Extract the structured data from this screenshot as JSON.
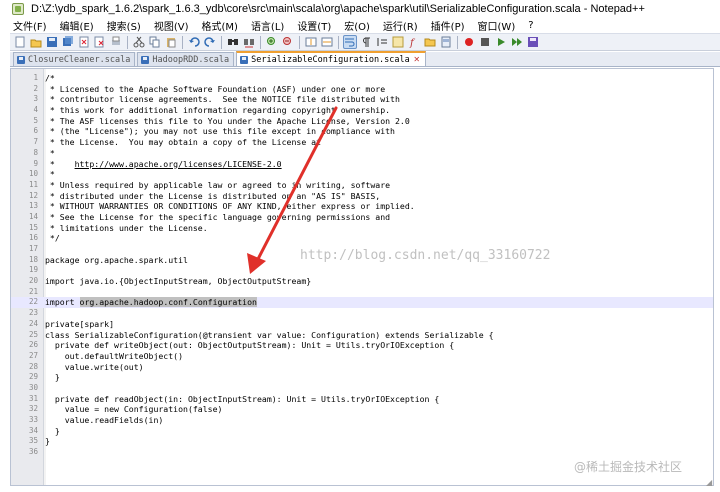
{
  "window": {
    "title": "D:\\Z:\\ydb_spark_1.6.2\\spark_1.6.3_ydb\\core\\src\\main\\scala\\org\\apache\\spark\\util\\SerializableConfiguration.scala - Notepad++"
  },
  "menu": [
    {
      "label": "文件(F)"
    },
    {
      "label": "编辑(E)"
    },
    {
      "label": "搜索(S)"
    },
    {
      "label": "视图(V)"
    },
    {
      "label": "格式(M)"
    },
    {
      "label": "语言(L)"
    },
    {
      "label": "设置(T)"
    },
    {
      "label": "宏(O)"
    },
    {
      "label": "运行(R)"
    },
    {
      "label": "插件(P)"
    },
    {
      "label": "窗口(W)"
    },
    {
      "label": "?"
    }
  ],
  "toolbar_icons": [
    "new-file-icon",
    "open-file-icon",
    "save-icon",
    "save-all-icon",
    "close-icon",
    "close-all-icon",
    "print-icon",
    "cut-icon",
    "copy-icon",
    "paste-icon",
    "undo-icon",
    "redo-icon",
    "find-icon",
    "replace-icon",
    "zoom-in-icon",
    "zoom-out-icon",
    "sync-vertical-icon",
    "sync-horizontal-icon",
    "word-wrap-icon",
    "show-all-characters-icon",
    "indent-guide-icon",
    "user-language-icon",
    "function-list-icon",
    "folder-workspace-icon",
    "document-map-icon",
    "record-macro-icon",
    "stop-macro-icon",
    "play-macro-icon",
    "play-multiple-macro-icon",
    "save-macro-icon"
  ],
  "colors": {
    "accent": "#f0a030",
    "arrow": "#e0302a",
    "current_line": "#e8e8ff",
    "selection": "#c0c0c0"
  },
  "tabs": [
    {
      "label": "ClosureCleaner.scala",
      "active": false
    },
    {
      "label": "HadoopRDD.scala",
      "active": false
    },
    {
      "label": "SerializableConfiguration.scala",
      "active": true
    }
  ],
  "editor": {
    "lines": [
      {
        "n": "1",
        "text": "/*"
      },
      {
        "n": "2",
        "text": " * Licensed to the Apache Software Foundation (ASF) under one or more"
      },
      {
        "n": "3",
        "text": " * contributor license agreements.  See the NOTICE file distributed with"
      },
      {
        "n": "4",
        "text": " * this work for additional information regarding copyright ownership."
      },
      {
        "n": "5",
        "text": " * The ASF licenses this file to You under the Apache License, Version 2.0"
      },
      {
        "n": "6",
        "text": " * (the \"License\"); you may not use this file except in compliance with"
      },
      {
        "n": "7",
        "text": " * the License.  You may obtain a copy of the License at"
      },
      {
        "n": "8",
        "text": " *"
      },
      {
        "n": "9",
        "text": " *    http://www.apache.org/licenses/LICENSE-2.0"
      },
      {
        "n": "10",
        "text": " *"
      },
      {
        "n": "11",
        "text": " * Unless required by applicable law or agreed to in writing, software"
      },
      {
        "n": "12",
        "text": " * distributed under the License is distributed on an \"AS IS\" BASIS,"
      },
      {
        "n": "13",
        "text": " * WITHOUT WARRANTIES OR CONDITIONS OF ANY KIND, either express or implied."
      },
      {
        "n": "14",
        "text": " * See the License for the specific language governing permissions and"
      },
      {
        "n": "15",
        "text": " * limitations under the License."
      },
      {
        "n": "16",
        "text": " */"
      },
      {
        "n": "17",
        "text": ""
      },
      {
        "n": "18",
        "text": "package org.apache.spark.util"
      },
      {
        "n": "19",
        "text": ""
      },
      {
        "n": "20",
        "text": "import java.io.{ObjectInputStream, ObjectOutputStream}"
      },
      {
        "n": "21",
        "text": ""
      },
      {
        "n": "22",
        "text": "import org.apache.hadoop.conf.Configuration"
      },
      {
        "n": "23",
        "text": ""
      },
      {
        "n": "24",
        "text": "private[spark]"
      },
      {
        "n": "25",
        "text": "class SerializableConfiguration(@transient var value: Configuration) extends Serializable {"
      },
      {
        "n": "26",
        "text": "  private def writeObject(out: ObjectOutputStream): Unit = Utils.tryOrIOException {"
      },
      {
        "n": "27",
        "text": "    out.defaultWriteObject()"
      },
      {
        "n": "28",
        "text": "    value.write(out)"
      },
      {
        "n": "29",
        "text": "  }"
      },
      {
        "n": "30",
        "text": ""
      },
      {
        "n": "31",
        "text": "  private def readObject(in: ObjectInputStream): Unit = Utils.tryOrIOException {"
      },
      {
        "n": "32",
        "text": "    value = new Configuration(false)"
      },
      {
        "n": "33",
        "text": "    value.readFields(in)"
      },
      {
        "n": "34",
        "text": "  }"
      },
      {
        "n": "35",
        "text": "}"
      },
      {
        "n": "36",
        "text": ""
      }
    ],
    "current_line_index": 21,
    "selection": {
      "line_index": 21,
      "prefix": "import ",
      "selected": "org.apache.hadoop.conf.Configuration"
    },
    "url_line_index": 8
  },
  "watermark": "http://blog.csdn.net/qq_33160722",
  "corner_watermark": "@稀土掘金技术社区"
}
